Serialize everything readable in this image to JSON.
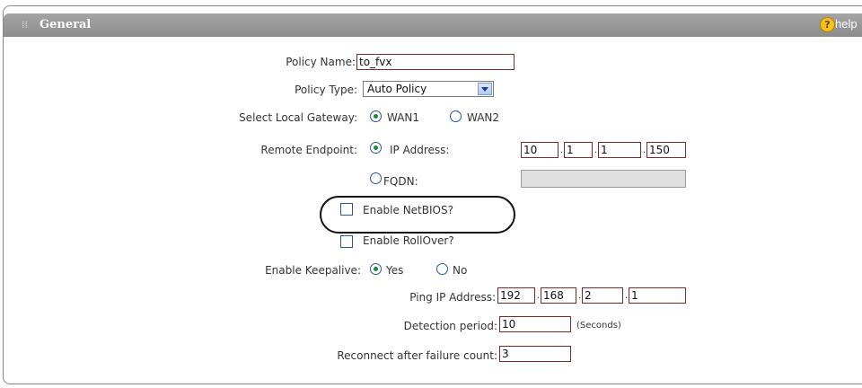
{
  "header": {
    "title": "General",
    "help_label": "help"
  },
  "policy_name": {
    "label": "Policy Name:",
    "value": "to_fvx"
  },
  "policy_type": {
    "label": "Policy Type:",
    "selected": "Auto Policy"
  },
  "local_gateway": {
    "label": "Select Local Gateway:",
    "options": [
      "WAN1",
      "WAN2"
    ],
    "selected": "WAN1"
  },
  "remote_endpoint": {
    "label": "Remote Endpoint:",
    "ip_label": "IP Address:",
    "ip": [
      "10",
      "1",
      "1",
      "150"
    ],
    "fqdn_label": "FQDN:",
    "fqdn_value": "",
    "selected": "IP Address"
  },
  "enable_netbios": {
    "label": "Enable NetBIOS?",
    "checked": false
  },
  "enable_rollover": {
    "label": "Enable RollOver?",
    "checked": false
  },
  "keepalive": {
    "label": "Enable Keepalive:",
    "options": [
      "Yes",
      "No"
    ],
    "selected": "Yes",
    "ping_label": "Ping IP Address:",
    "ping_ip": [
      "192",
      "168",
      "2",
      "1"
    ],
    "detection_label": "Detection period:",
    "detection_value": "10",
    "detection_unit": "(Seconds)",
    "reconnect_label": "Reconnect after failure count:",
    "reconnect_value": "3"
  },
  "colors": {
    "header_bg": "#9a9a9a",
    "input_border": "#7a2a2a",
    "radio_selected": "#1d8a3a"
  }
}
